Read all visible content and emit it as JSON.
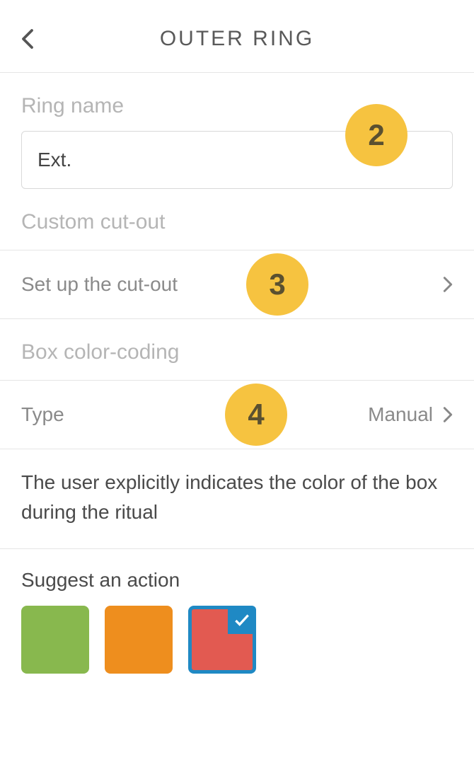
{
  "header": {
    "title": "OUTER RING"
  },
  "ring_name": {
    "label": "Ring name",
    "value": "Ext."
  },
  "cutout": {
    "label": "Custom cut-out",
    "row_label": "Set up the cut-out"
  },
  "color_coding": {
    "label": "Box color-coding",
    "type_label": "Type",
    "type_value": "Manual",
    "description": "The user explicitly indicates the color of the box during the ritual"
  },
  "action": {
    "label": "Suggest an action"
  },
  "callouts": {
    "c2": "2",
    "c3": "3",
    "c4": "4"
  },
  "colors": {
    "green": "#88b84e",
    "orange": "#ee8e1e",
    "red": "#e25a51",
    "blue": "#1f89c4",
    "badge": "#f6c340"
  }
}
